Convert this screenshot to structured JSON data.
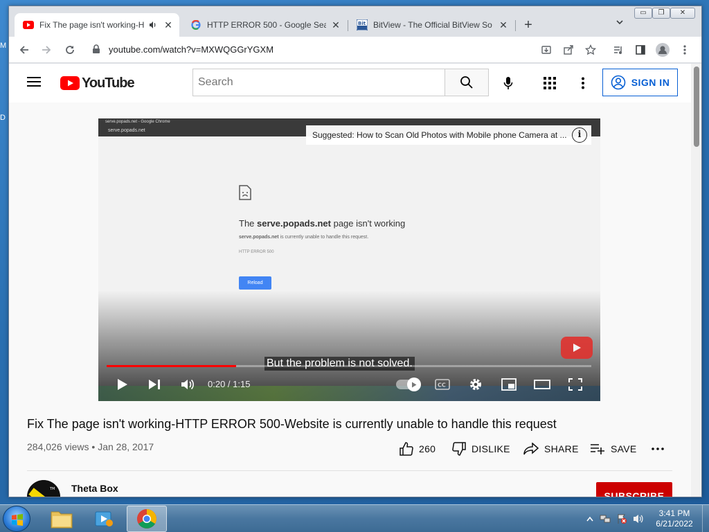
{
  "desktop": {
    "label_1": "M",
    "label_2": "D"
  },
  "browser": {
    "tabs": [
      {
        "title": "Fix The page isn't working-H",
        "active": true
      },
      {
        "title": "HTTP ERROR 500 - Google Searc",
        "active": false
      },
      {
        "title": "BitView - The Official BitView So",
        "active": false
      }
    ],
    "new_tab": "+",
    "url": "youtube.com/watch?v=MXWQGGrYGXM"
  },
  "youtube": {
    "logo_text": "YouTube",
    "search_placeholder": "Search",
    "sign_in": "SIGN IN"
  },
  "player": {
    "fake_window_title": "serve.popads.net - Google Chrome",
    "fake_url": "serve.popads.net",
    "error_host": "serve.popads.net",
    "error_title_prefix": "The",
    "error_title_suffix": "page isn't working",
    "error_line_host": "serve.popads.net",
    "error_line_rest": "is currently unable to handle this request.",
    "error_code": "HTTP ERROR 500",
    "reload": "Reload",
    "suggestion": "Suggested: How to Scan Old Photos with Mobile phone Camera at ...",
    "caption": "But the problem is not solved.",
    "time_current": "0:20",
    "time_total": "1:15",
    "time_separator": " / ",
    "progress_fraction": 0.267
  },
  "video": {
    "title": "Fix The page isn't working-HTTP ERROR 500-Website is currently unable to handle this request",
    "views": "284,026 views",
    "meta_separator": " • ",
    "date": "Jan 28, 2017",
    "likes": "260",
    "dislike": "DISLIKE",
    "share": "SHARE",
    "save": "SAVE"
  },
  "channel": {
    "name": "Theta Box",
    "subscribe": "SUBSCRIBE"
  },
  "taskbar": {
    "time": "3:41 PM",
    "date": "6/21/2022"
  },
  "colors": {
    "youtube_red": "#ff0000",
    "link_blue": "#065fd4",
    "subscribe_red": "#cc0000"
  }
}
